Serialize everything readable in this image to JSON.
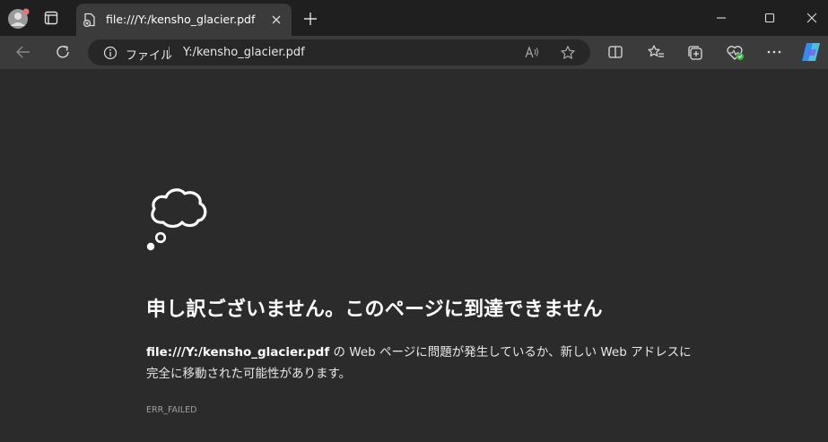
{
  "tab": {
    "title": "file:///Y:/kensho_glacier.pdf",
    "favicon": "file-error-icon"
  },
  "address_bar": {
    "scheme_label": "ファイル",
    "url": "Y:/kensho_glacier.pdf"
  },
  "toolbar_icons": [
    "back-icon",
    "refresh-icon",
    "read-aloud-icon",
    "favorite-star-icon",
    "split-screen-icon",
    "favorites-icon",
    "collections-icon",
    "browser-essentials-icon",
    "more-icon",
    "copilot-icon"
  ],
  "error": {
    "title": "申し訳ございません。このページに到達できません",
    "url_bold": "file:///Y:/kensho_glacier.pdf",
    "message_line1": " の Web ページに問題が発生しているか、新しい Web アドレスに",
    "message_line2": "完全に移動された可能性があります。",
    "code": "ERR_FAILED"
  },
  "colors": {
    "titlebar": "#1f1f1f",
    "toolbar": "#3b3b3b",
    "content": "#2b2b2b",
    "address_bg": "#272727"
  }
}
